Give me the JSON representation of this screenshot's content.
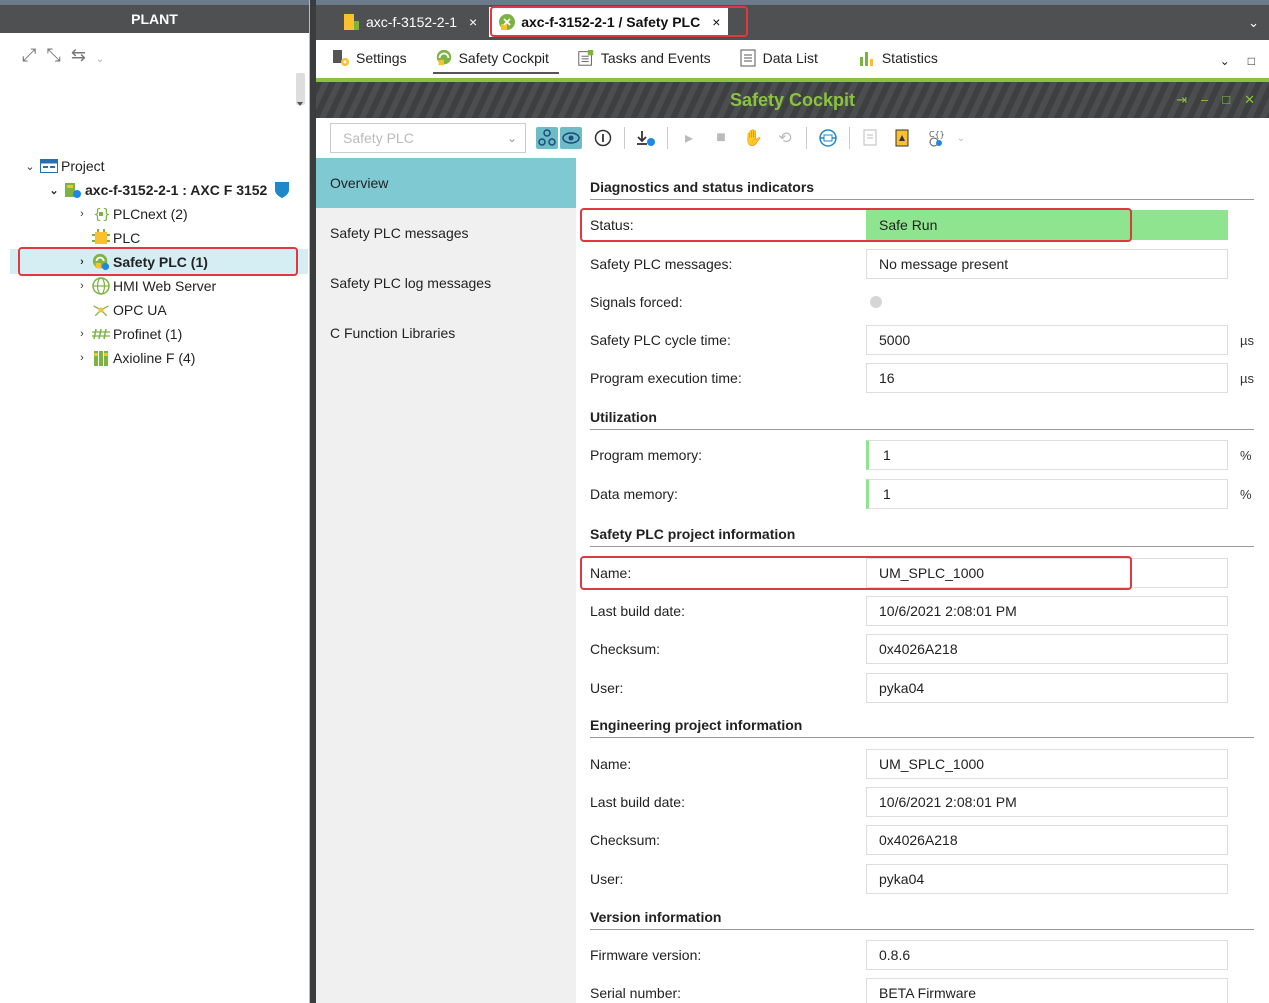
{
  "plant": {
    "title": "PLANT",
    "tree": [
      {
        "label": "Project"
      },
      {
        "label": "axc-f-3152-2-1 : AXC F 3152"
      },
      {
        "label": "PLCnext (2)"
      },
      {
        "label": "PLC"
      },
      {
        "label": "Safety PLC (1)"
      },
      {
        "label": "HMI Web Server"
      },
      {
        "label": "OPC UA"
      },
      {
        "label": "Profinet (1)"
      },
      {
        "label": "Axioline F (4)"
      }
    ]
  },
  "doc_tabs": [
    {
      "label": "axc-f-3152-2-1"
    },
    {
      "label": "axc-f-3152-2-1 / Safety PLC"
    }
  ],
  "sub_tabs": [
    {
      "label": "Settings"
    },
    {
      "label": "Safety Cockpit"
    },
    {
      "label": "Tasks and Events"
    },
    {
      "label": "Data List"
    },
    {
      "label": "Statistics"
    }
  ],
  "cockpit": {
    "title": "Safety Cockpit",
    "plc_select": "Safety PLC"
  },
  "nav": [
    {
      "label": "Overview"
    },
    {
      "label": "Safety PLC messages"
    },
    {
      "label": "Safety PLC log messages"
    },
    {
      "label": "C Function Libraries"
    }
  ],
  "sections": {
    "diag": "Diagnostics and status indicators",
    "util": "Utilization",
    "proj": "Safety PLC project information",
    "eng": "Engineering project information",
    "ver": "Version information"
  },
  "fields": {
    "status": {
      "label": "Status:",
      "value": "Safe Run"
    },
    "messages": {
      "label": "Safety PLC messages:",
      "value": "No message present"
    },
    "signals_forced": {
      "label": "Signals forced:"
    },
    "cycle_time": {
      "label": "Safety PLC cycle time:",
      "value": "5000",
      "unit": "µs"
    },
    "exec_time": {
      "label": "Program execution time:",
      "value": "16",
      "unit": "µs"
    },
    "prog_mem": {
      "label": "Program memory:",
      "value": "1",
      "unit": "%"
    },
    "data_mem": {
      "label": "Data memory:",
      "value": "1",
      "unit": "%"
    },
    "proj_name": {
      "label": "Name:",
      "value": "UM_SPLC_1000"
    },
    "proj_build": {
      "label": "Last build date:",
      "value": "10/6/2021 2:08:01 PM"
    },
    "proj_checksum": {
      "label": "Checksum:",
      "value": "0x4026A218"
    },
    "proj_user": {
      "label": "User:",
      "value": "pyka04"
    },
    "eng_name": {
      "label": "Name:",
      "value": "UM_SPLC_1000"
    },
    "eng_build": {
      "label": "Last build date:",
      "value": "10/6/2021 2:08:01 PM"
    },
    "eng_checksum": {
      "label": "Checksum:",
      "value": "0x4026A218"
    },
    "eng_user": {
      "label": "User:",
      "value": "pyka04"
    },
    "fw_version": {
      "label": "Firmware version:",
      "value": "0.8.6"
    },
    "serial": {
      "label": "Serial number:",
      "value": "BETA Firmware"
    }
  },
  "colors": {
    "accent_green": "#8ac43f",
    "status_green": "#8fe58f",
    "nav_active": "#7fc9d2",
    "highlight_red": "#e0383e"
  }
}
